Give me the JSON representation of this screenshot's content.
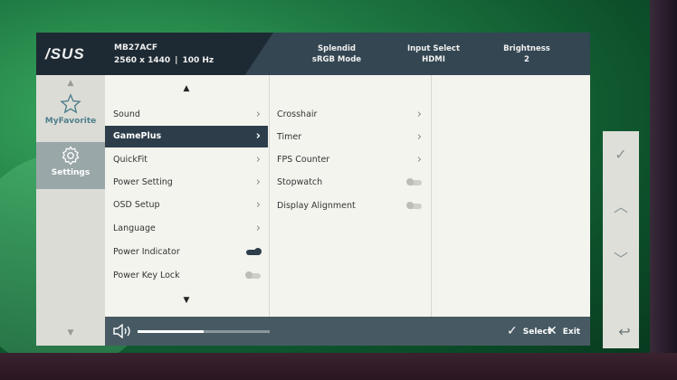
{
  "header": {
    "logo": "/SUS",
    "model": "MB27ACF",
    "resolution": "2560 x 1440",
    "refresh": "100 Hz",
    "splendid_label": "Splendid",
    "splendid_value": "sRGB Mode",
    "input_label": "Input Select",
    "input_value": "HDMI",
    "brightness_label": "Brightness",
    "brightness_value": "2"
  },
  "sidebar": {
    "items": [
      {
        "label": "MyFavorite",
        "icon": "star-icon"
      },
      {
        "label": "Settings",
        "icon": "gear-icon"
      }
    ]
  },
  "menu": {
    "items": [
      {
        "label": "Sound",
        "type": "submenu"
      },
      {
        "label": "GamePlus",
        "type": "submenu",
        "selected": true
      },
      {
        "label": "QuickFit",
        "type": "submenu"
      },
      {
        "label": "Power Setting",
        "type": "submenu"
      },
      {
        "label": "OSD Setup",
        "type": "submenu"
      },
      {
        "label": "Language",
        "type": "submenu"
      },
      {
        "label": "Power Indicator",
        "type": "toggle",
        "on": true
      },
      {
        "label": "Power Key Lock",
        "type": "toggle",
        "on": false
      }
    ]
  },
  "submenu": {
    "items": [
      {
        "label": "Crosshair",
        "type": "submenu"
      },
      {
        "label": "Timer",
        "type": "submenu"
      },
      {
        "label": "FPS Counter",
        "type": "submenu"
      },
      {
        "label": "Stopwatch",
        "type": "toggle",
        "on": false
      },
      {
        "label": "Display Alignment",
        "type": "toggle",
        "on": false
      }
    ]
  },
  "footer": {
    "volume_fraction": 0.5,
    "select_label": "Select",
    "exit_label": "Exit"
  },
  "colors": {
    "header_bg": "#334652",
    "selected_bg": "#2d3e4a",
    "panel_bg": "#f4f4ef",
    "footer_bg": "#475a63"
  }
}
